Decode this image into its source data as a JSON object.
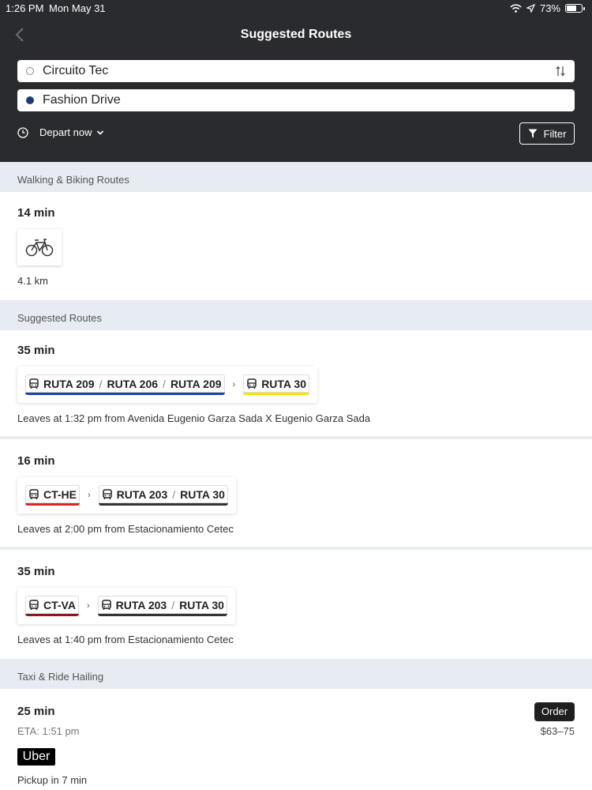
{
  "status": {
    "time": "1:26 PM",
    "date": "Mon May 31",
    "battery": "73%",
    "battery_level": 0.73
  },
  "nav": {
    "title": "Suggested Routes"
  },
  "search": {
    "origin": "Circuito Tec",
    "destination": "Fashion Drive"
  },
  "depart": {
    "label": "Depart now"
  },
  "filter": {
    "label": "Filter"
  },
  "sections": {
    "walking": "Walking & Biking Routes",
    "suggested": "Suggested Routes",
    "taxi": "Taxi & Ride Hailing"
  },
  "bike_route": {
    "duration": "14 min",
    "distance": "4.1 km",
    "icon": "bicycle-icon"
  },
  "routes": [
    {
      "duration": "35 min",
      "legs": [
        {
          "lines": [
            "RUTA 209",
            "RUTA 206",
            "RUTA 209"
          ],
          "color": "#1f3fb0"
        },
        {
          "lines": [
            "RUTA 30"
          ],
          "color": "#f2e600"
        }
      ],
      "leaves": "Leaves at 1:32 pm from Avenida Eugenio Garza Sada X Eugenio Garza Sada"
    },
    {
      "duration": "16 min",
      "legs": [
        {
          "lines": [
            "CT-HE"
          ],
          "color": "#d6262a"
        },
        {
          "lines": [
            "RUTA 203",
            "RUTA 30"
          ],
          "color": "#333333"
        }
      ],
      "leaves": "Leaves at 2:00 pm from Estacionamiento Cetec"
    },
    {
      "duration": "35 min",
      "legs": [
        {
          "lines": [
            "CT-VA"
          ],
          "color": "#8b1a1a"
        },
        {
          "lines": [
            "RUTA 203",
            "RUTA 30"
          ],
          "color": "#333333"
        }
      ],
      "leaves": "Leaves at 1:40 pm from Estacionamiento Cetec"
    }
  ],
  "taxi": {
    "duration": "25 min",
    "eta": "ETA: 1:51 pm",
    "order_label": "Order",
    "price": "$63–75",
    "provider": "Uber",
    "pickup": "Pickup in 7 min"
  },
  "colors": {
    "header_bg": "#2a2b2f",
    "section_bg": "#e6ecf2",
    "dest_dot": "#1e3a78"
  }
}
